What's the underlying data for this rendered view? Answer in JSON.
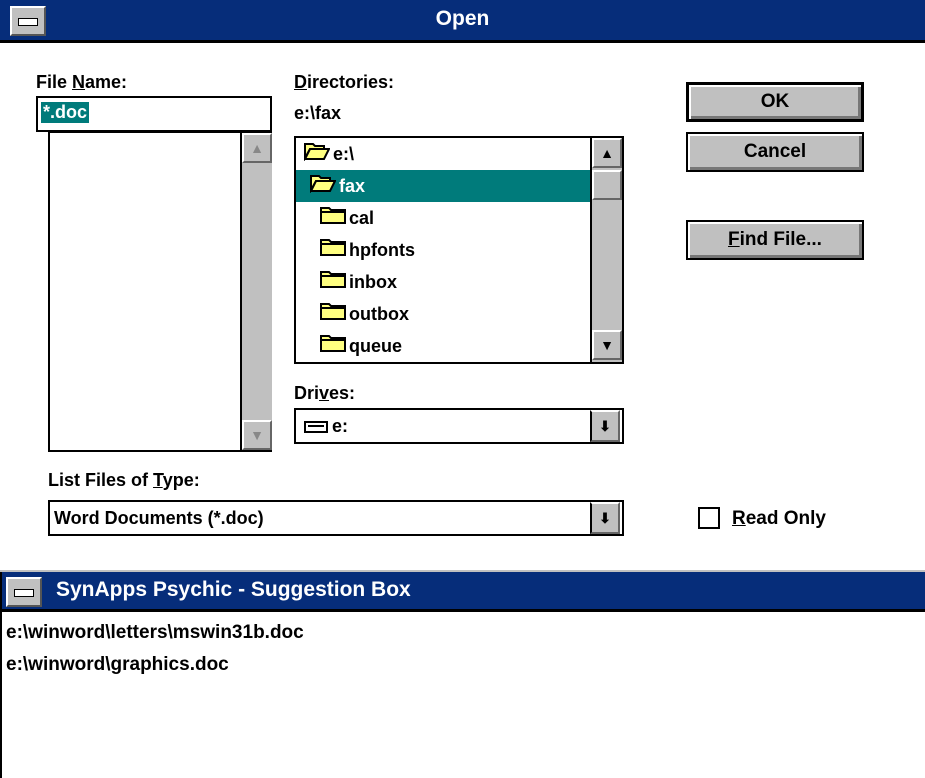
{
  "open_dialog": {
    "title": "Open",
    "file_name": {
      "label_pre": "File ",
      "label_u": "N",
      "label_post": "ame:",
      "value": "*.doc"
    },
    "directories": {
      "label_u": "D",
      "label_post": "irectories:",
      "current_path": "e:\\fax",
      "items": [
        {
          "name": "e:\\",
          "type": "open-folder"
        },
        {
          "name": "fax",
          "type": "open-folder"
        },
        {
          "name": "cal",
          "type": "folder"
        },
        {
          "name": "hpfonts",
          "type": "folder"
        },
        {
          "name": "inbox",
          "type": "folder"
        },
        {
          "name": "outbox",
          "type": "folder"
        },
        {
          "name": "queue",
          "type": "folder"
        }
      ],
      "selected_index": 1
    },
    "drives": {
      "label_pre": "Dri",
      "label_u": "v",
      "label_post": "es:",
      "value": "e:"
    },
    "file_type": {
      "label_pre": "List Files of ",
      "label_u": "T",
      "label_post": "ype:",
      "value": "Word Documents (*.doc)"
    },
    "buttons": {
      "ok": "OK",
      "cancel": "Cancel",
      "find_u": "F",
      "find_post": "ind File..."
    },
    "read_only": {
      "label_u": "R",
      "label_post": "ead Only",
      "checked": false
    }
  },
  "suggestion_box": {
    "title": "SynApps Psychic - Suggestion Box",
    "items": [
      "e:\\winword\\letters\\mswin31b.doc",
      "e:\\winword\\graphics.doc"
    ]
  },
  "colors": {
    "title_bar": "#062d7a",
    "selection": "#007b7b",
    "face": "#c0c0c0"
  }
}
